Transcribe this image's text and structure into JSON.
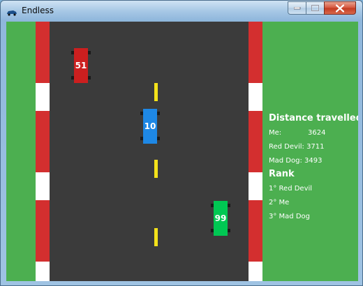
{
  "window": {
    "title": "Endless"
  },
  "cars": [
    {
      "number": "51",
      "color": "#cc1f1f"
    },
    {
      "number": "10",
      "color": "#1e88e5"
    },
    {
      "number": "99",
      "color": "#00c853"
    }
  ],
  "hud": {
    "distance_heading": "Distance travelled",
    "distances": [
      {
        "name": "Me:",
        "value": "3624"
      },
      {
        "name": "Red Devil:",
        "value": "3711"
      },
      {
        "name": "Mad Dog:",
        "value": "3493"
      }
    ],
    "rank_heading": "Rank",
    "ranks": [
      "1° Red Devil",
      "2° Me",
      "3° Mad Dog"
    ]
  }
}
